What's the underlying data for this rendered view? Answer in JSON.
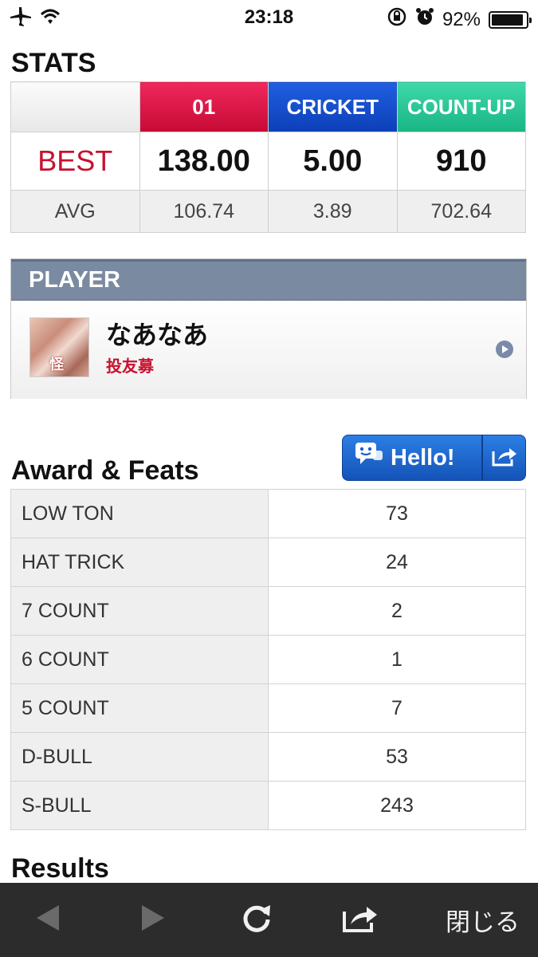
{
  "status_bar": {
    "time": "23:18",
    "battery_text": "92%",
    "battery_level": 0.92,
    "icons": [
      "airplane-icon",
      "wifi-icon",
      "rotation-lock-icon",
      "alarm-icon",
      "battery-icon"
    ]
  },
  "stats": {
    "title": "STATS",
    "columns": [
      "01",
      "CRICKET",
      "COUNT-UP"
    ],
    "column_colors": [
      "#d9163f",
      "#1348c9",
      "#2bc794"
    ],
    "best": {
      "label": "BEST",
      "values": [
        "138.00",
        "5.00",
        "910"
      ]
    },
    "avg": {
      "label": "AVG",
      "values": [
        "106.74",
        "3.89",
        "702.64"
      ]
    }
  },
  "player": {
    "header": "PLAYER",
    "name": "なあなあ",
    "tag": "投友募"
  },
  "hello_button": {
    "label": "Hello!"
  },
  "awards": {
    "title": "Award & Feats",
    "rows": [
      {
        "label": "LOW TON",
        "value": "73"
      },
      {
        "label": "HAT TRICK",
        "value": "24"
      },
      {
        "label": "7 COUNT",
        "value": "2"
      },
      {
        "label": "6 COUNT",
        "value": "1"
      },
      {
        "label": "5 COUNT",
        "value": "7"
      },
      {
        "label": "D-BULL",
        "value": "53"
      },
      {
        "label": "S-BULL",
        "value": "243"
      }
    ]
  },
  "results": {
    "title": "Results"
  },
  "toolbar": {
    "close_label": "閉じる",
    "icons": [
      "back-arrow-icon",
      "forward-arrow-icon",
      "reload-icon",
      "share-icon"
    ]
  }
}
